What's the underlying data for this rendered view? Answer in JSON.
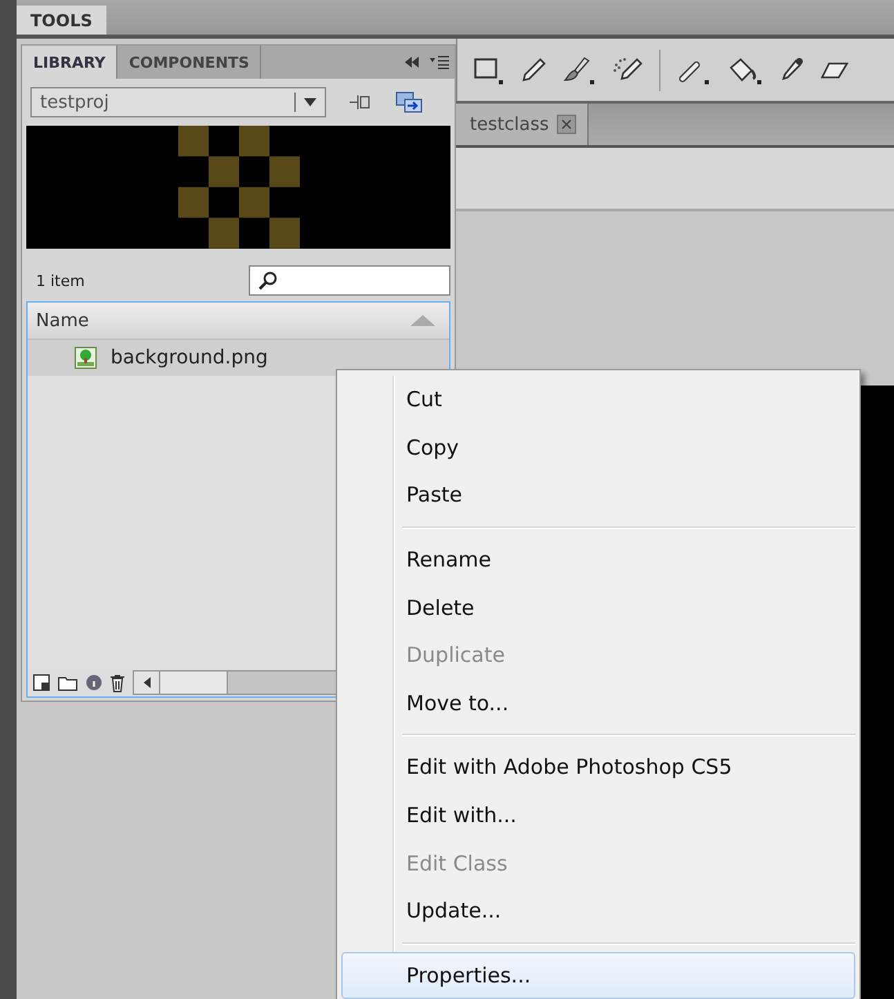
{
  "top_tabs": [
    {
      "label": "TOOLS",
      "selected": true
    }
  ],
  "library": {
    "tabs": [
      {
        "label": "LIBRARY",
        "selected": true
      },
      {
        "label": "COMPONENTS",
        "selected": false
      }
    ],
    "project": "testproj",
    "item_count": "1 item",
    "column": "Name",
    "items": [
      {
        "name": "background.png",
        "selected": true
      }
    ]
  },
  "document_tabs": [
    {
      "label": "testclass",
      "selected": true
    }
  ],
  "context_menu": {
    "groups": [
      [
        {
          "label": "Cut",
          "disabled": false,
          "selected": false
        },
        {
          "label": "Copy",
          "disabled": false,
          "selected": false
        },
        {
          "label": "Paste",
          "disabled": false,
          "selected": false
        }
      ],
      [
        {
          "label": "Rename",
          "disabled": false,
          "selected": false
        },
        {
          "label": "Delete",
          "disabled": false,
          "selected": false
        },
        {
          "label": "Duplicate",
          "disabled": true,
          "selected": false
        },
        {
          "label": "Move to...",
          "disabled": false,
          "selected": false
        }
      ],
      [
        {
          "label": "Edit with Adobe Photoshop CS5",
          "disabled": false,
          "selected": false
        },
        {
          "label": "Edit with...",
          "disabled": false,
          "selected": false
        },
        {
          "label": "Edit Class",
          "disabled": true,
          "selected": false
        },
        {
          "label": "Update...",
          "disabled": false,
          "selected": false
        }
      ],
      [
        {
          "label": "Properties...",
          "disabled": false,
          "selected": true
        }
      ]
    ]
  }
}
